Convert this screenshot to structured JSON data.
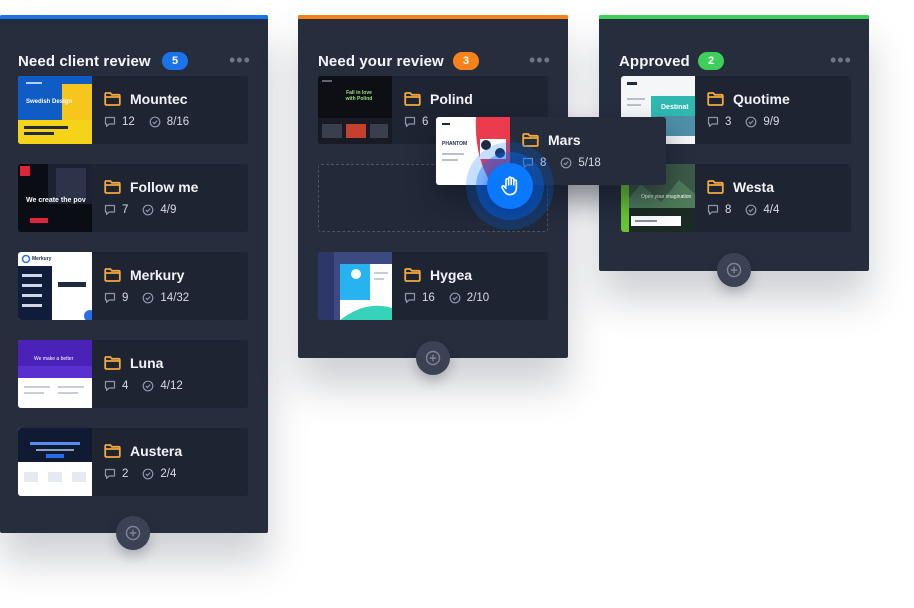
{
  "columns": [
    {
      "title": "Need client review",
      "count": "5",
      "accent": "#1a73e8",
      "badge_color": "#1a73e8",
      "cards": [
        {
          "name": "Mountec",
          "comments": "12",
          "tasks": "8/16",
          "thumb_text": "Swedish Design"
        },
        {
          "name": "Follow me",
          "comments": "7",
          "tasks": "4/9",
          "thumb_text": "We create the pov"
        },
        {
          "name": "Merkury",
          "comments": "9",
          "tasks": "14/32",
          "thumb_text": "Merkury"
        },
        {
          "name": "Luna",
          "comments": "4",
          "tasks": "4/12",
          "thumb_text": "We make a better"
        },
        {
          "name": "Austera",
          "comments": "2",
          "tasks": "2/4",
          "thumb_text": ""
        }
      ]
    },
    {
      "title": "Need your review",
      "count": "3",
      "accent": "#f7821b",
      "badge_color": "#f7821b",
      "cards": [
        {
          "name": "Polind",
          "comments": "6",
          "tasks": "",
          "thumb_text": "Fall in love with Polind"
        },
        {
          "name": "Hygea",
          "comments": "16",
          "tasks": "2/10",
          "thumb_text": ""
        }
      ]
    },
    {
      "title": "Approved",
      "count": "2",
      "accent": "#3ecf5a",
      "badge_color": "#3ecf5a",
      "cards": [
        {
          "name": "Quotime",
          "comments": "3",
          "tasks": "9/9",
          "thumb_text": "Destinat"
        },
        {
          "name": "Westa",
          "comments": "8",
          "tasks": "4/4",
          "thumb_text": "Open your imagination"
        }
      ]
    }
  ],
  "dragging_card": {
    "name": "Mars",
    "comments": "8",
    "tasks": "5/18",
    "thumb_text": "PHANTOM"
  },
  "icons": {
    "folder": "folder-icon",
    "comment": "comment-icon",
    "check": "check-circle-icon",
    "more": "more-dots-icon",
    "add": "add-circle-icon",
    "grab": "grab-hand-icon"
  },
  "colors": {
    "folder": "#f3a83c",
    "column_bg": "#262d3d",
    "card_bg": "#1e2432",
    "grab": "#0a78ff"
  }
}
